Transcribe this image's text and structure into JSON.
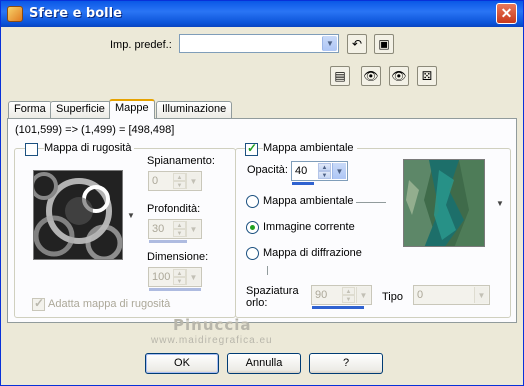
{
  "window": {
    "title": "Sfere e bolle",
    "close_glyph": "✕"
  },
  "preset": {
    "label": "Imp. predef.:",
    "value": ""
  },
  "tabs": [
    {
      "label": "Forma",
      "active": false
    },
    {
      "label": "Superficie",
      "active": false
    },
    {
      "label": "Mappe",
      "active": true
    },
    {
      "label": "Illuminazione",
      "active": false
    }
  ],
  "coords": "(101,599) => (1,499) = [498,498]",
  "bump": {
    "title": "Mappa di rugosità",
    "checked": false,
    "spacing_label": "Spianamento:",
    "spacing_value": "0",
    "depth_label": "Profondità:",
    "depth_value": "30",
    "depth_level": 0.3,
    "size_label": "Dimensione:",
    "size_value": "100",
    "size_level": 1.0,
    "adapt_label": "Adatta mappa di rugosità",
    "adapt_checked": true
  },
  "env": {
    "title": "Mappa ambientale",
    "checked": true,
    "opacity_label": "Opacità:",
    "opacity_value": "40",
    "opacity_level": 0.4,
    "radio_env": "Mappa ambientale",
    "radio_current": "Immagine corrente",
    "radio_diffraction": "Mappa di diffrazione",
    "selected": "Immagine corrente",
    "spacing_label": "Spaziatura orlo:",
    "spacing_value": "90",
    "spacing_level": 0.9,
    "type_label": "Tipo",
    "type_value": "0"
  },
  "watermark": {
    "line1": "Pinuccia",
    "line2": "www.maidiregrafica.eu"
  },
  "buttons": {
    "ok": "OK",
    "cancel": "Annulla",
    "help": "?"
  },
  "colors": {
    "titlebar": "#0a58e6",
    "accent": "#2f62d0",
    "tab_highlight": "#e6a200"
  }
}
